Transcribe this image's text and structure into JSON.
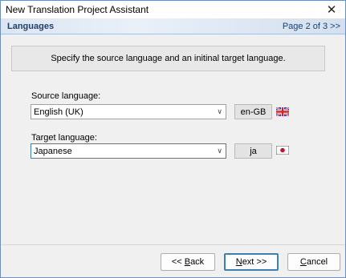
{
  "window": {
    "title": "New Translation Project Assistant"
  },
  "header": {
    "title": "Languages",
    "page_indicator": "Page 2 of 3 >>"
  },
  "main": {
    "instructions": "Specify the source language and an initinal target language.",
    "source": {
      "label": "Source language:",
      "value": "English (UK)",
      "code": "en-GB",
      "flag_icon": "uk-flag-icon"
    },
    "target": {
      "label": "Target language:",
      "value": "Japanese",
      "code": "ja",
      "flag_icon": "japan-flag-icon"
    }
  },
  "footer": {
    "back_prefix": "<< ",
    "back_hotkey": "B",
    "back_rest": "ack",
    "next_hotkey": "N",
    "next_rest": "ext >>",
    "cancel_hotkey": "C",
    "cancel_rest": "ancel"
  },
  "colors": {
    "accent": "#3c7fb1",
    "header_text": "#1c3f6e"
  }
}
